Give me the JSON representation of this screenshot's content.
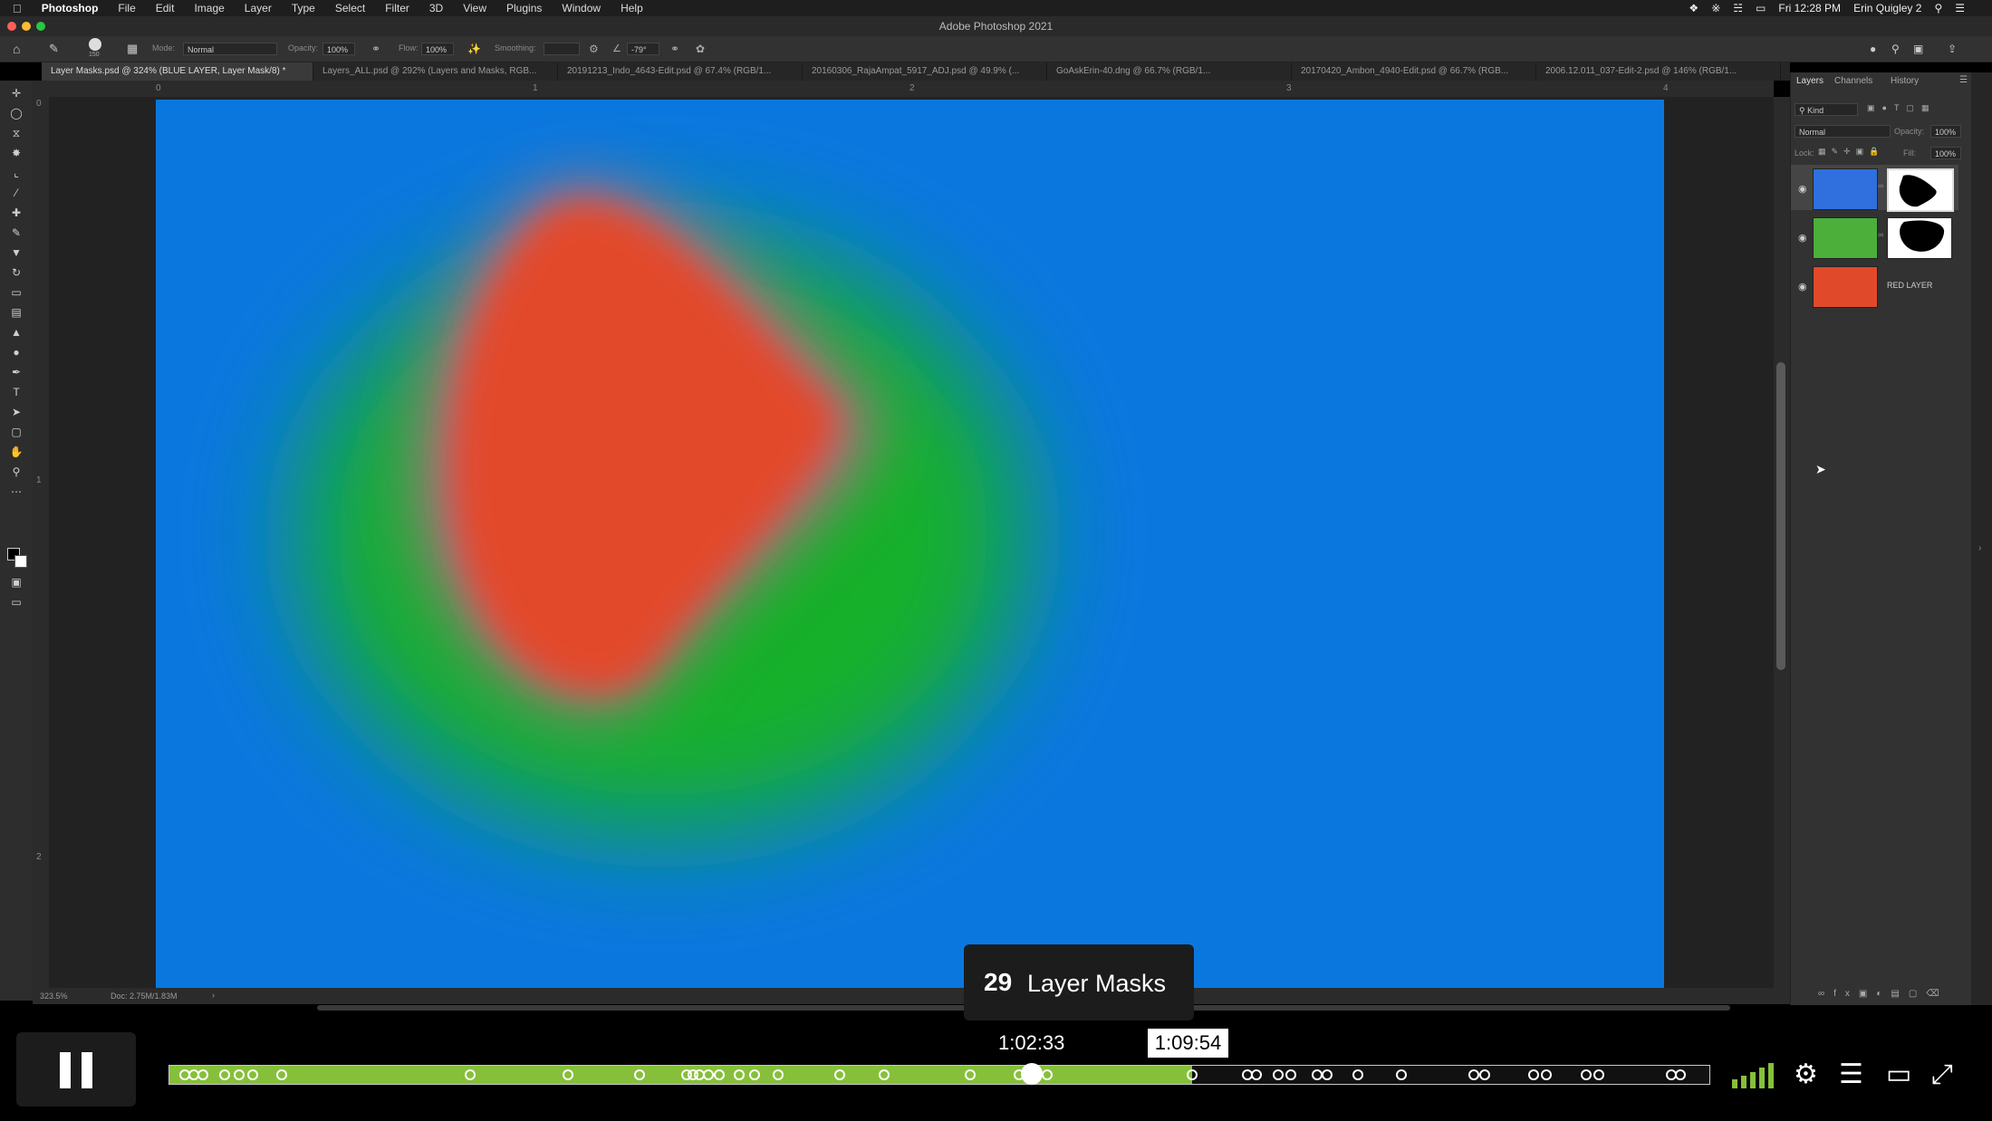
{
  "menubar": {
    "apple": "",
    "items": [
      "Photoshop",
      "File",
      "Edit",
      "Image",
      "Layer",
      "Type",
      "Select",
      "Filter",
      "3D",
      "View",
      "Plugins",
      "Window",
      "Help"
    ],
    "clock": "Fri 12:28 PM",
    "user": "Erin Quigley 2"
  },
  "window": {
    "title": "Adobe Photoshop 2021"
  },
  "options": {
    "brush_size": "150",
    "mode_label": "Mode:",
    "mode_value": "Normal",
    "opacity_label": "Opacity:",
    "opacity_value": "100%",
    "flow_label": "Flow:",
    "flow_value": "100%",
    "smoothing_label": "Smoothing:",
    "angle_value": "-79°"
  },
  "tabs": [
    "Layer Masks.psd @ 324% (BLUE LAYER, Layer Mask/8) *",
    "Layers_ALL.psd @ 292% (Layers and Masks, RGB...",
    "20191213_Indo_4643-Edit.psd @ 67.4% (RGB/1...",
    "20160306_RajaAmpat_5917_ADJ.psd @ 49.9% (...",
    "GoAskErin-40.dng @ 66.7% (RGB/1...",
    "20170420_Ambon_4940-Edit.psd @ 66.7% (RGB...",
    "2006.12.011_037-Edit-2.psd @ 146% (RGB/1..."
  ],
  "ruler": {
    "h_labels": [
      "0",
      "1",
      "2",
      "3",
      "4"
    ],
    "v_labels": [
      "0",
      "1",
      "2"
    ]
  },
  "status": {
    "zoom": "323.5%",
    "doc": "Doc: 2.75M/1.83M"
  },
  "panel": {
    "tabs": [
      "Layers",
      "Channels",
      "History"
    ],
    "kind_label": "Kind",
    "blend_mode": "Normal",
    "opacity_label": "Opacity:",
    "opacity_value": "100%",
    "lock_label": "Lock:",
    "fill_label": "Fill:",
    "fill_value": "100%",
    "layers": [
      {
        "color": "#2f6fde",
        "has_mask": true,
        "name": ""
      },
      {
        "color": "#4caf3a",
        "has_mask": true,
        "name": ""
      },
      {
        "color": "#e04a2a",
        "has_mask": false,
        "name": "RED LAYER"
      }
    ]
  },
  "player": {
    "chapter_number": "29",
    "chapter_title": "Layer Masks",
    "hover_time": "1:02:33",
    "current_time": "1:09:54",
    "progress": 0.664,
    "hover_position": 0.56,
    "accent": "#86c03a",
    "chapter_marks": [
      0.01,
      0.016,
      0.022,
      0.036,
      0.045,
      0.054,
      0.073,
      0.195,
      0.259,
      0.305,
      0.336,
      0.34,
      0.344,
      0.35,
      0.357,
      0.37,
      0.38,
      0.395,
      0.435,
      0.464,
      0.52,
      0.552,
      0.57,
      0.664,
      0.7,
      0.706,
      0.72,
      0.728,
      0.745,
      0.752,
      0.772,
      0.8,
      0.847,
      0.854,
      0.886,
      0.894,
      0.92,
      0.928,
      0.975,
      0.981
    ],
    "icons": [
      "pause-icon",
      "signal-bars-icon",
      "gear-icon",
      "list-icon",
      "airplay-icon",
      "fullscreen-icon"
    ]
  }
}
